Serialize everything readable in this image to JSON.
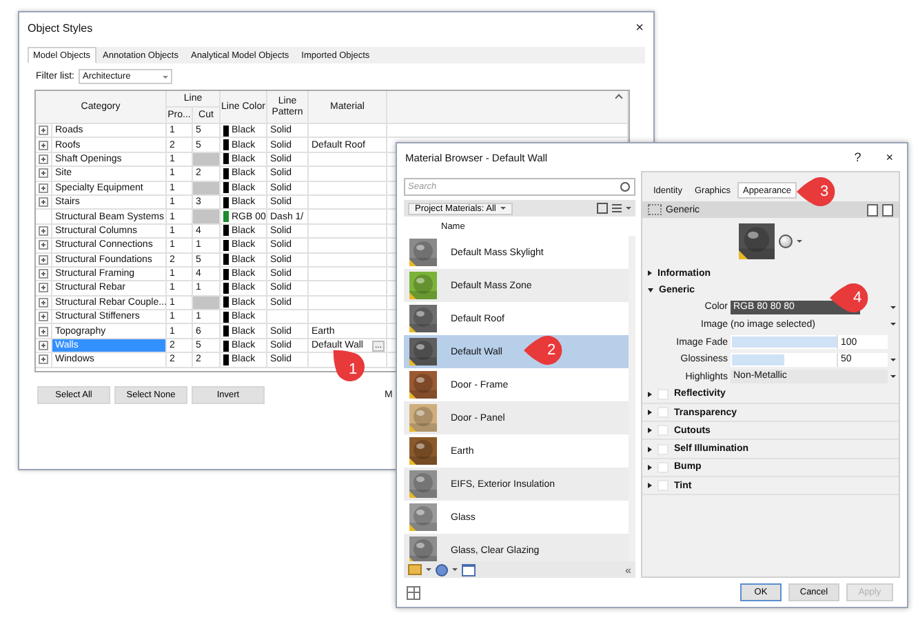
{
  "object_styles": {
    "title": "Object Styles",
    "close": "×",
    "tabs": [
      {
        "label": "Model Objects",
        "selected": true
      },
      {
        "label": "Annotation Objects",
        "selected": false
      },
      {
        "label": "Analytical Model Objects",
        "selected": false
      },
      {
        "label": "Imported Objects",
        "selected": false
      }
    ],
    "filter": {
      "label": "Filter list:",
      "value": "Architecture"
    },
    "table": {
      "columns": {
        "category": "Category",
        "line": "Line",
        "projection": "Pro...",
        "cut": "Cut",
        "line_color": "Line Color",
        "line_pattern": "Line Pattern",
        "material": "Material"
      },
      "rows": [
        {
          "expandable": true,
          "selected": false,
          "category": "Roads",
          "projection": "1",
          "cut": "5",
          "color": "#000000",
          "color_name": "Black",
          "pattern": "Solid"
        },
        {
          "expandable": true,
          "selected": false,
          "category": "Roofs",
          "projection": "2",
          "cut": "5",
          "color": "#000000",
          "color_name": "Black",
          "pattern": "Solid",
          "material": "Default Roof"
        },
        {
          "expandable": true,
          "selected": false,
          "category": "Shaft Openings",
          "projection": "1",
          "color": "#000000",
          "color_name": "Black",
          "pattern": "Solid"
        },
        {
          "expandable": true,
          "selected": false,
          "category": "Site",
          "projection": "1",
          "cut": "2",
          "color": "#000000",
          "color_name": "Black",
          "pattern": "Solid"
        },
        {
          "expandable": true,
          "selected": false,
          "category": "Specialty Equipment",
          "projection": "1",
          "color": "#000000",
          "color_name": "Black",
          "pattern": "Solid"
        },
        {
          "expandable": true,
          "selected": false,
          "category": "Stairs",
          "projection": "1",
          "cut": "3",
          "color": "#000000",
          "color_name": "Black",
          "pattern": "Solid"
        },
        {
          "expandable": false,
          "selected": false,
          "category": "Structural Beam Systems",
          "projection": "1",
          "color": "#1e8c2e",
          "color_name": "RGB 00",
          "pattern": "Dash 1/"
        },
        {
          "expandable": true,
          "selected": false,
          "category": "Structural Columns",
          "projection": "1",
          "cut": "4",
          "color": "#000000",
          "color_name": "Black",
          "pattern": "Solid"
        },
        {
          "expandable": true,
          "selected": false,
          "category": "Structural Connections",
          "projection": "1",
          "cut": "1",
          "color": "#000000",
          "color_name": "Black",
          "pattern": "Solid"
        },
        {
          "expandable": true,
          "selected": false,
          "category": "Structural Foundations",
          "projection": "2",
          "cut": "5",
          "color": "#000000",
          "color_name": "Black",
          "pattern": "Solid"
        },
        {
          "expandable": true,
          "selected": false,
          "category": "Structural Framing",
          "projection": "1",
          "cut": "4",
          "color": "#000000",
          "color_name": "Black",
          "pattern": "Solid"
        },
        {
          "expandable": true,
          "selected": false,
          "category": "Structural Rebar",
          "projection": "1",
          "cut": "1",
          "color": "#000000",
          "color_name": "Black",
          "pattern": "Solid"
        },
        {
          "expandable": true,
          "selected": false,
          "category": "Structural Rebar Couple...",
          "projection": "1",
          "color": "#000000",
          "color_name": "Black",
          "pattern": "Solid"
        },
        {
          "expandable": true,
          "selected": false,
          "category": "Structural Stiffeners",
          "projection": "1",
          "cut": "1",
          "color": "#000000",
          "color_name": "Black"
        },
        {
          "expandable": true,
          "selected": false,
          "category": "Topography",
          "projection": "1",
          "cut": "6",
          "color": "#000000",
          "color_name": "Black",
          "pattern": "Solid",
          "material": "Earth"
        },
        {
          "expandable": true,
          "selected": true,
          "category": "Walls",
          "projection": "2",
          "cut": "5",
          "color": "#000000",
          "color_name": "Black",
          "pattern": "Solid",
          "material": "Default Wall",
          "browse_button": "..."
        },
        {
          "expandable": true,
          "selected": false,
          "category": "Windows",
          "projection": "2",
          "cut": "2",
          "color": "#000000",
          "color_name": "Black",
          "pattern": "Solid"
        }
      ]
    },
    "buttons": [
      "Select All",
      "Select None",
      "Invert"
    ],
    "subcategories_label": "M"
  },
  "material_browser": {
    "title": "Material Browser - Default Wall",
    "help": "?",
    "close": "×",
    "search": {
      "placeholder": "Search"
    },
    "filter": "Project Materials: All",
    "list_header": "Name",
    "materials": [
      {
        "name": "Default Mass Skylight",
        "selected": false,
        "color": "#8a8a8a"
      },
      {
        "name": "Default Mass Zone",
        "selected": false,
        "color": "#7bb33a"
      },
      {
        "name": "Default Roof",
        "selected": false,
        "color": "#6e6e6e"
      },
      {
        "name": "Default Wall",
        "selected": true,
        "color": "#5e5e5e"
      },
      {
        "name": "Door - Frame",
        "selected": false,
        "color": "#9a5a32"
      },
      {
        "name": "Door - Panel",
        "selected": false,
        "color": "#cfae7e"
      },
      {
        "name": "Earth",
        "selected": false,
        "color": "#8b5a2b"
      },
      {
        "name": "EIFS, Exterior Insulation",
        "selected": false,
        "color": "#8f8f8f"
      },
      {
        "name": "Glass",
        "selected": false,
        "color": "#9a9a9a"
      },
      {
        "name": "Glass, Clear Glazing",
        "selected": false,
        "color": "#8c8c8c"
      }
    ],
    "collapse_label": "«",
    "tabs": [
      {
        "label": "Identity",
        "selected": false
      },
      {
        "label": "Graphics",
        "selected": false
      },
      {
        "label": "Appearance",
        "selected": true
      }
    ],
    "asset_name": "Generic",
    "sections": [
      {
        "label": "Information",
        "expanded": false,
        "kind": "plain"
      },
      {
        "label": "Generic",
        "expanded": true,
        "kind": "plain",
        "properties": [
          {
            "label": "Color",
            "kind": "color",
            "value": "RGB 80 80 80",
            "has_menu": true
          },
          {
            "label": "Image",
            "kind": "text",
            "value": "(no image selected)",
            "has_menu": true
          },
          {
            "label": "Image Fade",
            "kind": "slider",
            "level": 1.0,
            "reading": "100",
            "has_menu": false
          },
          {
            "label": "Glossiness",
            "kind": "slider",
            "level": 0.5,
            "reading": "50",
            "has_menu": true
          },
          {
            "label": "Highlights",
            "kind": "dropdown",
            "value": "Non-Metallic",
            "has_menu": true
          }
        ]
      },
      {
        "label": "Reflectivity",
        "expanded": false,
        "kind": "checkbox",
        "checked": false
      },
      {
        "label": "Transparency",
        "expanded": false,
        "kind": "checkbox",
        "checked": false
      },
      {
        "label": "Cutouts",
        "expanded": false,
        "kind": "checkbox",
        "checked": false
      },
      {
        "label": "Self Illumination",
        "expanded": false,
        "kind": "checkbox",
        "checked": false
      },
      {
        "label": "Bump",
        "expanded": false,
        "kind": "checkbox",
        "checked": false
      },
      {
        "label": "Tint",
        "expanded": false,
        "kind": "checkbox",
        "checked": false
      }
    ],
    "buttons": [
      {
        "label": "OK",
        "disabled": false
      },
      {
        "label": "Cancel",
        "disabled": false
      },
      {
        "label": "Apply",
        "disabled": true
      }
    ]
  },
  "callouts": [
    {
      "label": "1"
    },
    {
      "label": "2"
    },
    {
      "label": "3"
    },
    {
      "label": "4"
    }
  ]
}
